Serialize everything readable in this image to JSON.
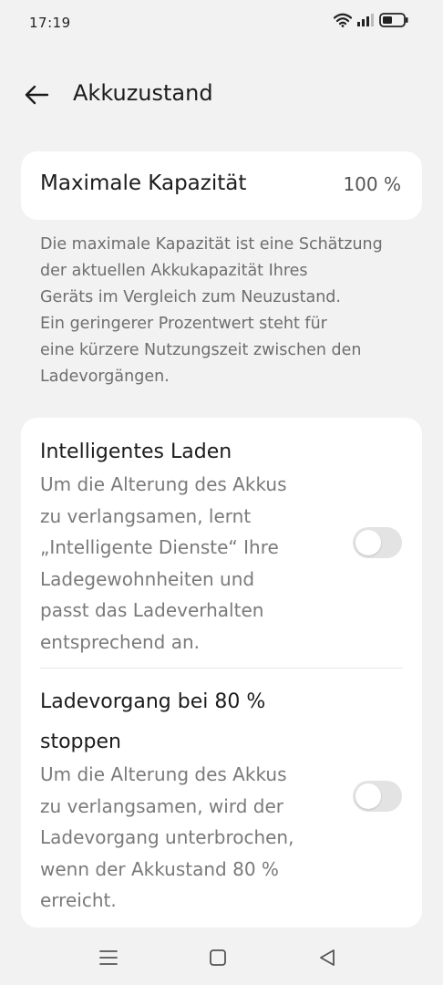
{
  "status_bar": {
    "time": "17:19"
  },
  "header": {
    "title": "Akkuzustand"
  },
  "capacity": {
    "label": "Maximale Kapazität",
    "value": "100 %"
  },
  "description": {
    "lines": [
      "Die maximale Kapazität ist eine Schätzung",
      "der aktuellen Akkukapazität Ihres",
      "Geräts im Vergleich zum Neuzustand.",
      "Ein geringerer Prozentwert steht für",
      "eine kürzere Nutzungszeit zwischen den",
      "Ladevorgängen."
    ]
  },
  "settings": [
    {
      "title_lines": [
        "Intelligentes Laden"
      ],
      "desc_lines": [
        "Um die Alterung des Akkus",
        "zu verlangsamen,  lernt",
        "„Intelligente Dienste“ Ihre",
        "Ladegewohnheiten und",
        "passt das Ladeverhalten",
        "entsprechend an."
      ],
      "enabled": false
    },
    {
      "title_lines": [
        "Ladevorgang bei 80 %",
        "stoppen"
      ],
      "desc_lines": [
        "Um die Alterung des Akkus",
        "zu verlangsamen,  wird der",
        "Ladevorgang unterbrochen,",
        "wenn der Akkustand 80 %",
        "erreicht."
      ],
      "enabled": false
    }
  ],
  "colors": {
    "background": "#f2f2f2",
    "card": "#ffffff",
    "toggle_off": "#e3e3e3",
    "secondary_text": "#6e6e6e"
  },
  "icons": {
    "back": "arrow-left-icon",
    "wifi": "wifi-icon",
    "signal": "signal-icon",
    "battery": "battery-icon",
    "nav_menu": "menu-icon",
    "nav_home": "square-icon",
    "nav_back": "triangle-back-icon"
  }
}
